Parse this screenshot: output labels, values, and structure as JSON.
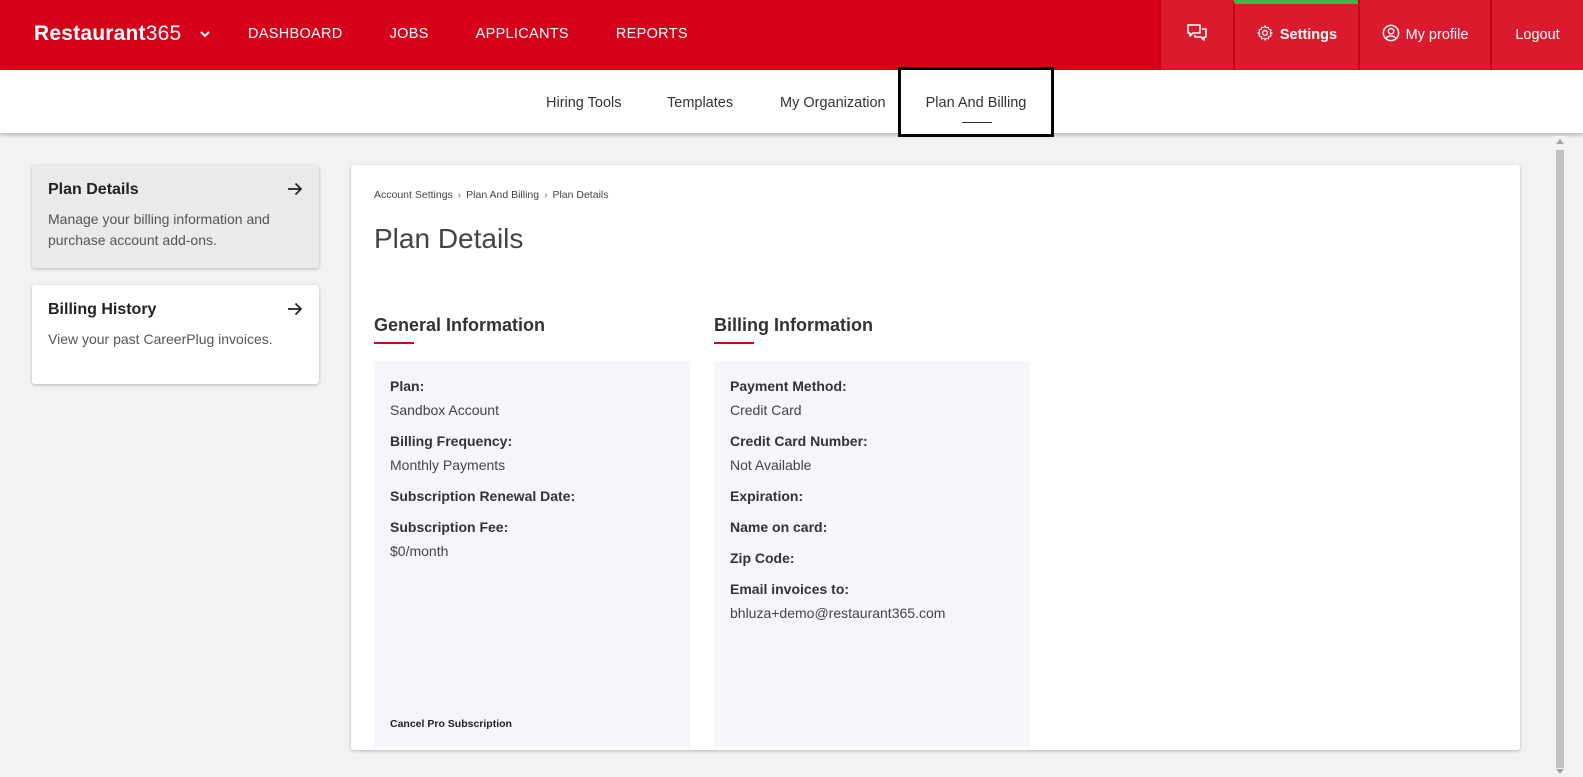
{
  "topnav": {
    "brand_bold": "Restaurant",
    "brand_num": "365",
    "items": [
      {
        "label": "DASHBOARD"
      },
      {
        "label": "JOBS"
      },
      {
        "label": "APPLICANTS"
      },
      {
        "label": "REPORTS"
      }
    ],
    "settings_label": "Settings",
    "profile_label": "My profile",
    "logout_label": "Logout"
  },
  "subnav": {
    "tabs": [
      {
        "label": "Hiring Tools"
      },
      {
        "label": "Templates"
      },
      {
        "label": "My Organization"
      },
      {
        "label": "Plan And Billing",
        "active": true
      }
    ]
  },
  "sidebar": {
    "items": [
      {
        "title": "Plan Details",
        "desc": "Manage your billing information and purchase account add-ons.",
        "active": true
      },
      {
        "title": "Billing History",
        "desc": "View your past CareerPlug invoices."
      }
    ]
  },
  "main": {
    "breadcrumb": [
      "Account Settings",
      "Plan And Billing",
      "Plan Details"
    ],
    "title": "Plan Details",
    "general": {
      "title": "General Information",
      "fields": [
        {
          "label": "Plan:",
          "value": "Sandbox Account"
        },
        {
          "label": "Billing Frequency:",
          "value": "Monthly Payments"
        },
        {
          "label": "Subscription Renewal Date:",
          "value": ""
        },
        {
          "label": "Subscription Fee:",
          "value": "$0/month"
        }
      ],
      "cancel_link": "Cancel Pro Subscription"
    },
    "billing": {
      "title": "Billing Information",
      "fields": [
        {
          "label": "Payment Method:",
          "value": "Credit Card"
        },
        {
          "label": "Credit Card Number:",
          "value": "Not Available"
        },
        {
          "label": "Expiration:",
          "value": ""
        },
        {
          "label": "Name on card:",
          "value": ""
        },
        {
          "label": "Zip Code:",
          "value": ""
        },
        {
          "label": "Email invoices to:",
          "value": "bhluza+demo@restaurant365.com"
        }
      ]
    }
  },
  "colors": {
    "brand_red": "#d50019",
    "active_indicator_green": "#3bb54a"
  }
}
